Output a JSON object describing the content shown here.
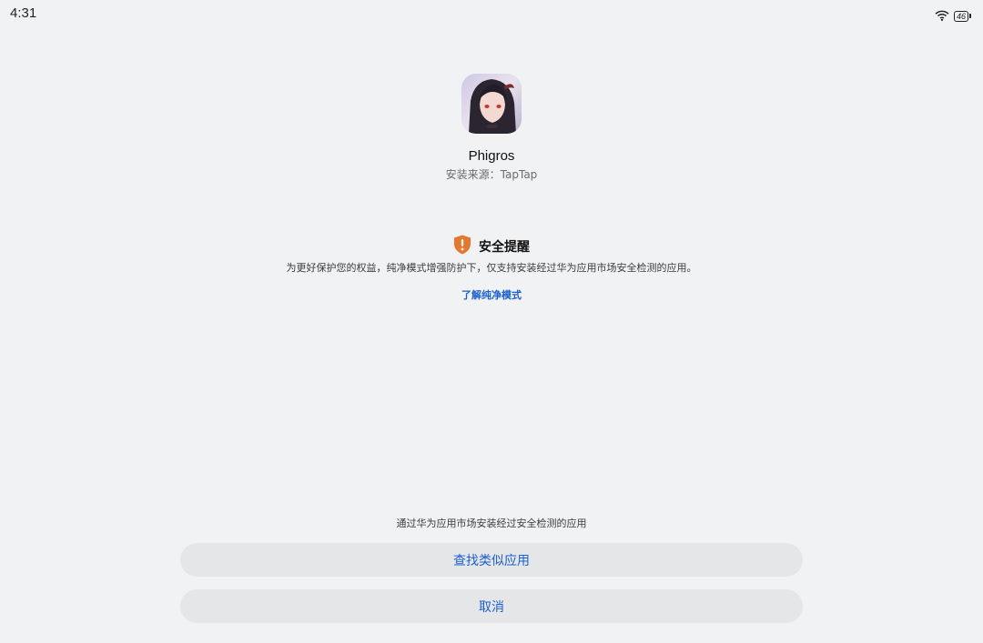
{
  "status_bar": {
    "time": "4:31",
    "battery_level": "46",
    "wifi_icon": "wifi-icon"
  },
  "app": {
    "name": "Phigros",
    "install_source": "安装来源：TapTap",
    "icon": "app-icon"
  },
  "security_notice": {
    "icon": "shield-warning-icon",
    "title": "安全提醒",
    "message": "为更好保护您的权益，纯净模式增强防护下，仅支持安装经过华为应用市场安全检测的应用。",
    "learn_more": "了解纯净模式"
  },
  "footer": {
    "hint": "通过华为应用市场安装经过安全检测的应用",
    "find_similar_label": "查找类似应用",
    "cancel_label": "取消"
  },
  "colors": {
    "background": "#f1f2f4",
    "accent": "#1a5fd6",
    "warning": "#e8762c",
    "button_bg": "#e5e6e8"
  }
}
